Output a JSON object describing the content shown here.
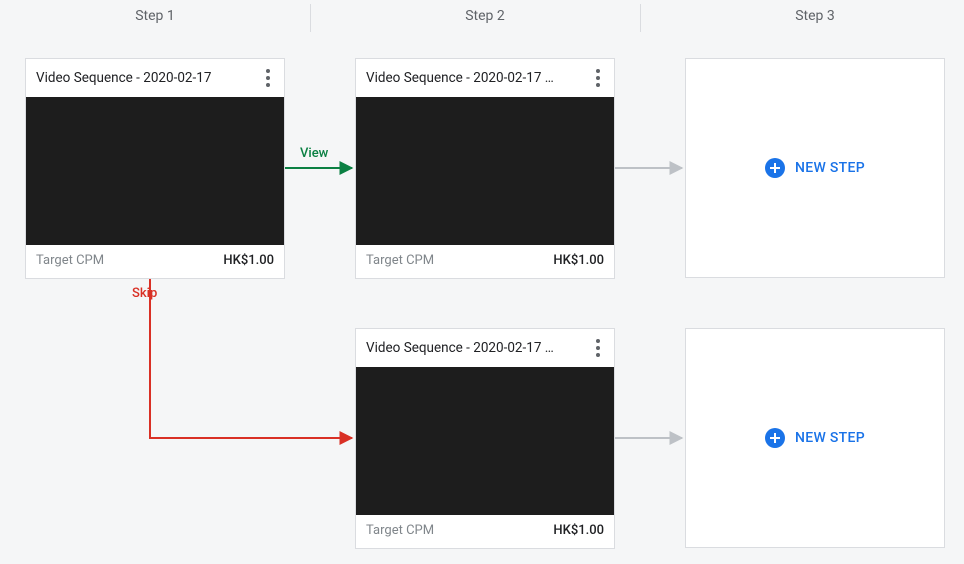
{
  "headers": {
    "step1": "Step 1",
    "step2": "Step 2",
    "step3": "Step 3"
  },
  "cards": {
    "s1": {
      "title": "Video Sequence - 2020-02-17",
      "footer_label": "Target CPM",
      "footer_value": "HK$1.00"
    },
    "s2a": {
      "title": "Video Sequence - 2020-02-17 …",
      "footer_label": "Target CPM",
      "footer_value": "HK$1.00"
    },
    "s2b": {
      "title": "Video Sequence - 2020-02-17 …",
      "footer_label": "Target CPM",
      "footer_value": "HK$1.00"
    }
  },
  "connectors": {
    "view": "View",
    "skip": "Skip"
  },
  "new_step_label": "NEW STEP",
  "colors": {
    "view": "#0b8043",
    "skip": "#d93025",
    "neutral_arrow": "#bdc1c6",
    "accent": "#1a73e8"
  }
}
